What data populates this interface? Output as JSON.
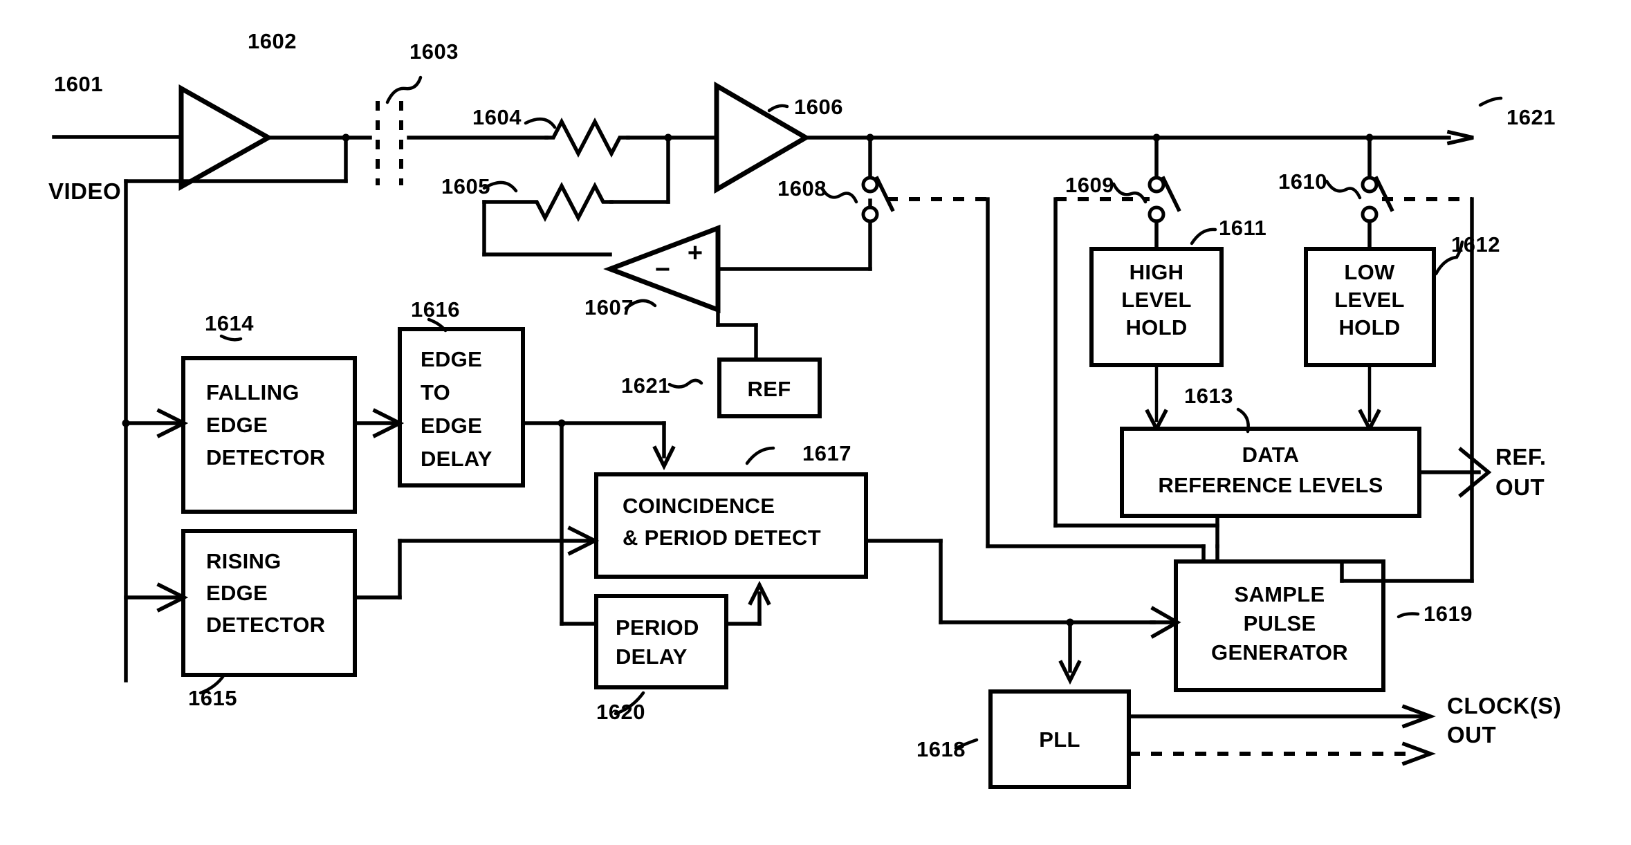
{
  "figure": {
    "title": "Video sync / data reference level recovery block diagram",
    "reference_numerals": {
      "n1601": "1601",
      "n1602": "1602",
      "n1603": "1603",
      "n1604": "1604",
      "n1605": "1605",
      "n1606": "1606",
      "n1607": "1607",
      "n1608": "1608",
      "n1609": "1609",
      "n1610": "1610",
      "n1611": "1611",
      "n1612": "1612",
      "n1613": "1613",
      "n1614": "1614",
      "n1615": "1615",
      "n1616": "1616",
      "n1617": "1617",
      "n1618": "1618",
      "n1619": "1619",
      "n1620": "1620",
      "n1621_ref": "1621",
      "n1621_out": "1621"
    },
    "io_labels": {
      "video_in": "VIDEO",
      "ref_out_line1": "REF.",
      "ref_out_line2": "OUT",
      "clocks_out_line1": "CLOCK(S)",
      "clocks_out_line2": "OUT"
    },
    "comparator_signs": {
      "plus": "+",
      "minus": "−"
    },
    "blocks": [
      {
        "id": "falling_edge_detector",
        "lines": [
          "FALLING",
          "EDGE",
          "DETECTOR"
        ],
        "numeral": "1614"
      },
      {
        "id": "rising_edge_detector",
        "lines": [
          "RISING",
          "EDGE",
          "DETECTOR"
        ],
        "numeral": "1615"
      },
      {
        "id": "edge_to_edge_delay",
        "lines": [
          "EDGE",
          "TO",
          "EDGE",
          "DELAY"
        ],
        "numeral": "1616"
      },
      {
        "id": "coincidence_period_detect",
        "lines": [
          "COINCIDENCE",
          "& PERIOD DETECT"
        ],
        "numeral": "1617"
      },
      {
        "id": "period_delay",
        "lines": [
          "PERIOD",
          "DELAY"
        ],
        "numeral": "1620"
      },
      {
        "id": "pll",
        "lines": [
          "PLL"
        ],
        "numeral": "1618"
      },
      {
        "id": "sample_pulse_generator",
        "lines": [
          "SAMPLE",
          "PULSE",
          "GENERATOR"
        ],
        "numeral": "1619"
      },
      {
        "id": "high_level_hold",
        "lines": [
          "HIGH",
          "LEVEL",
          "HOLD"
        ],
        "numeral": "1611"
      },
      {
        "id": "low_level_hold",
        "lines": [
          "LOW",
          "LEVEL",
          "HOLD"
        ],
        "numeral": "1612"
      },
      {
        "id": "data_reference_levels",
        "lines": [
          "DATA",
          "REFERENCE LEVELS"
        ],
        "numeral": "1613"
      },
      {
        "id": "ref",
        "lines": [
          "REF"
        ],
        "numeral": "1621"
      }
    ],
    "block_text": {
      "falling1": "FALLING",
      "falling2": "EDGE",
      "falling3": "DETECTOR",
      "rising1": "RISING",
      "rising2": "EDGE",
      "rising3": "DETECTOR",
      "e2e1": "EDGE",
      "e2e2": "TO",
      "e2e3": "EDGE",
      "e2e4": "DELAY",
      "coin1": "COINCIDENCE",
      "coin2": "& PERIOD DETECT",
      "perd1": "PERIOD",
      "perd2": "DELAY",
      "pll1": "PLL",
      "spg1": "SAMPLE",
      "spg2": "PULSE",
      "spg3": "GENERATOR",
      "hlh1": "HIGH",
      "hlh2": "LEVEL",
      "hlh3": "HOLD",
      "llh1": "LOW",
      "llh2": "LEVEL",
      "llh3": "HOLD",
      "drl1": "DATA",
      "drl2": "REFERENCE LEVELS",
      "ref1": "REF"
    },
    "colors": {
      "ink": "#000000",
      "paper": "#ffffff"
    }
  }
}
